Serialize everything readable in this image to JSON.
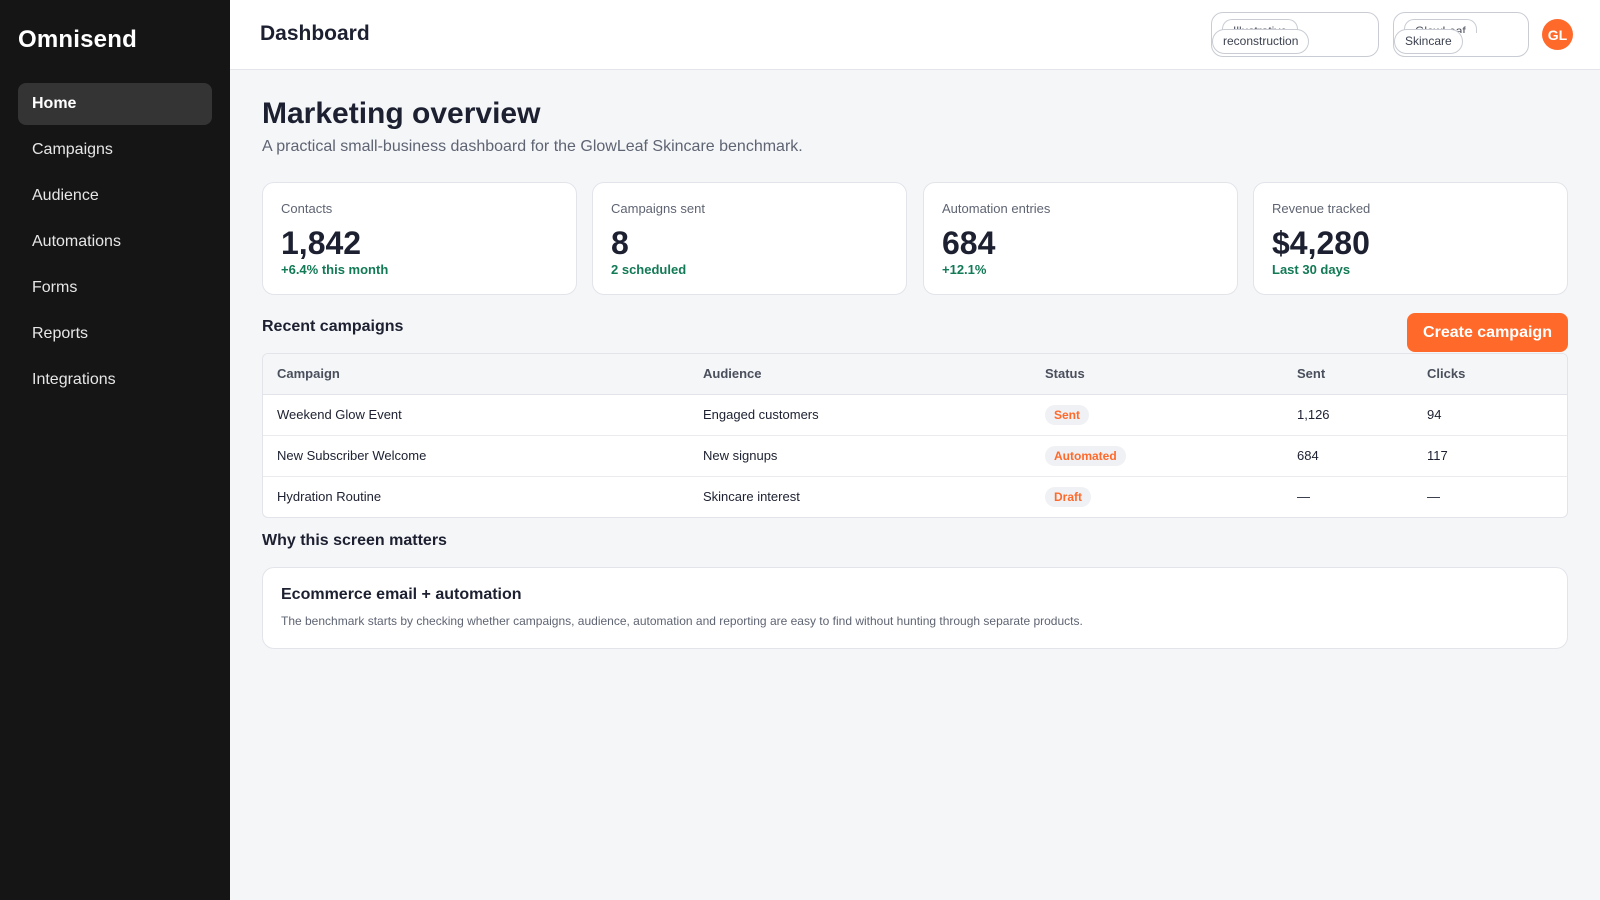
{
  "sidebar": {
    "brand": "Omnisend",
    "items": [
      {
        "label": "Home",
        "active": true
      },
      {
        "label": "Campaigns"
      },
      {
        "label": "Audience"
      },
      {
        "label": "Automations"
      },
      {
        "label": "Forms"
      },
      {
        "label": "Reports"
      },
      {
        "label": "Integrations"
      }
    ]
  },
  "header": {
    "title": "Dashboard",
    "chips": [
      {
        "top": "Illustrative",
        "bottom": "reconstruction"
      },
      {
        "top": "GlowLeaf",
        "bottom": "Skincare"
      }
    ],
    "avatar": "GL"
  },
  "main": {
    "title": "Marketing overview",
    "subtitle": "A practical small-business dashboard for the GlowLeaf Skincare benchmark.",
    "stats": [
      {
        "label": "Contacts",
        "value": "1,842",
        "delta": "+6.4% this month"
      },
      {
        "label": "Campaigns sent",
        "value": "8",
        "delta": "2 scheduled"
      },
      {
        "label": "Automation entries",
        "value": "684",
        "delta": "+12.1%"
      },
      {
        "label": "Revenue tracked",
        "value": "$4,280",
        "delta": "Last 30 days"
      }
    ],
    "recent_title": "Recent campaigns",
    "cta_label": "Create campaign",
    "table": {
      "headers": [
        "Campaign",
        "Audience",
        "Status",
        "Sent",
        "Clicks"
      ],
      "rows": [
        {
          "campaign": "Weekend Glow Event",
          "audience": "Engaged customers",
          "status": "Sent",
          "sent": "1,126",
          "clicks": "94"
        },
        {
          "campaign": "New Subscriber Welcome",
          "audience": "New signups",
          "status": "Automated",
          "sent": "684",
          "clicks": "117"
        },
        {
          "campaign": "Hydration Routine",
          "audience": "Skincare interest",
          "status": "Draft",
          "sent": "—",
          "clicks": "—"
        }
      ]
    },
    "why_title": "Why this screen matters",
    "info": {
      "title": "Ecommerce email + automation",
      "body": "The benchmark starts by checking whether campaigns, audience, automation and reporting are easy to find without hunting through separate products."
    }
  },
  "colors": {
    "accent": "#ff6a2b",
    "positive": "#127a55",
    "sidebar_bg": "#151515"
  }
}
